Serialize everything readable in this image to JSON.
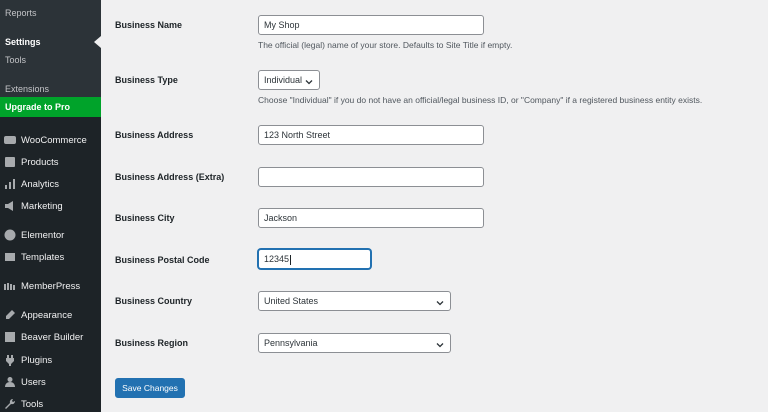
{
  "sidebar": {
    "submenu": [
      "Reports",
      "Settings",
      "Tools"
    ],
    "extensions": "Extensions",
    "upgrade": "Upgrade to Pro",
    "menu": [
      {
        "label": "WooCommerce",
        "icon": "woocommerce-icon"
      },
      {
        "label": "Products",
        "icon": "products-icon"
      },
      {
        "label": "Analytics",
        "icon": "analytics-icon"
      },
      {
        "label": "Marketing",
        "icon": "marketing-icon"
      },
      {
        "label": "Elementor",
        "icon": "elementor-icon"
      },
      {
        "label": "Templates",
        "icon": "templates-icon"
      },
      {
        "label": "MemberPress",
        "icon": "memberpress-icon"
      },
      {
        "label": "Appearance",
        "icon": "appearance-icon"
      },
      {
        "label": "Beaver Builder",
        "icon": "beaver-builder-icon"
      },
      {
        "label": "Plugins",
        "icon": "plugins-icon"
      },
      {
        "label": "Users",
        "icon": "users-icon"
      },
      {
        "label": "Tools",
        "icon": "tools-icon"
      }
    ]
  },
  "form": {
    "business_name": {
      "label": "Business Name",
      "value": "My Shop",
      "desc": "The official (legal) name of your store. Defaults to Site Title if empty."
    },
    "business_type": {
      "label": "Business Type",
      "value": "Individual",
      "desc": "Choose \"Individual\" if you do not have an official/legal business ID, or \"Company\" if a registered business entity exists."
    },
    "business_address": {
      "label": "Business Address",
      "value": "123 North Street"
    },
    "business_address_extra": {
      "label": "Business Address (Extra)",
      "value": ""
    },
    "business_city": {
      "label": "Business City",
      "value": "Jackson"
    },
    "business_postal_code": {
      "label": "Business Postal Code",
      "value": "12345"
    },
    "business_country": {
      "label": "Business Country",
      "value": "United States"
    },
    "business_region": {
      "label": "Business Region",
      "value": "Pennsylvania"
    },
    "save_label": "Save Changes"
  },
  "colors": {
    "sidebar_bg": "#1d2327",
    "upgrade_bg": "#00a32a",
    "primary": "#2271b1"
  }
}
